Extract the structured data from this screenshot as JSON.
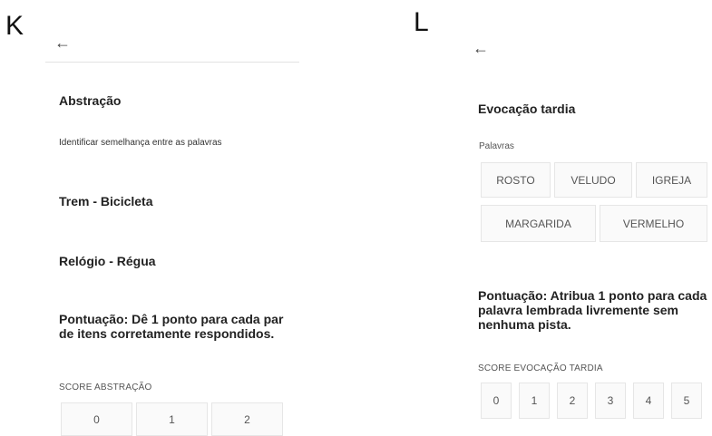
{
  "panel_k": {
    "letter": "K",
    "back_icon": "arrow-left-icon",
    "title": "Abstração",
    "subtitle": "Identificar semelhança entre as palavras",
    "items": [
      "Trem - Bicicleta",
      "Relógio - Régua"
    ],
    "scoring": "Pontuação: Dê 1 ponto para cada par de itens corretamente respondidos.",
    "score_label": "SCORE ABSTRAÇÃO",
    "score_options": [
      "0",
      "1",
      "2"
    ]
  },
  "panel_l": {
    "letter": "L",
    "back_icon": "arrow-left-icon",
    "title": "Evocação tardia",
    "words_label": "Palavras",
    "words": [
      "ROSTO",
      "VELUDO",
      "IGREJA",
      "MARGARIDA",
      "VERMELHO"
    ],
    "scoring": "Pontuação: Atribua 1 ponto para cada palavra lembrada livremente sem nenhuma pista.",
    "score_label": "SCORE EVOCAÇÃO TARDIA",
    "score_options": [
      "0",
      "1",
      "2",
      "3",
      "4",
      "5"
    ]
  }
}
